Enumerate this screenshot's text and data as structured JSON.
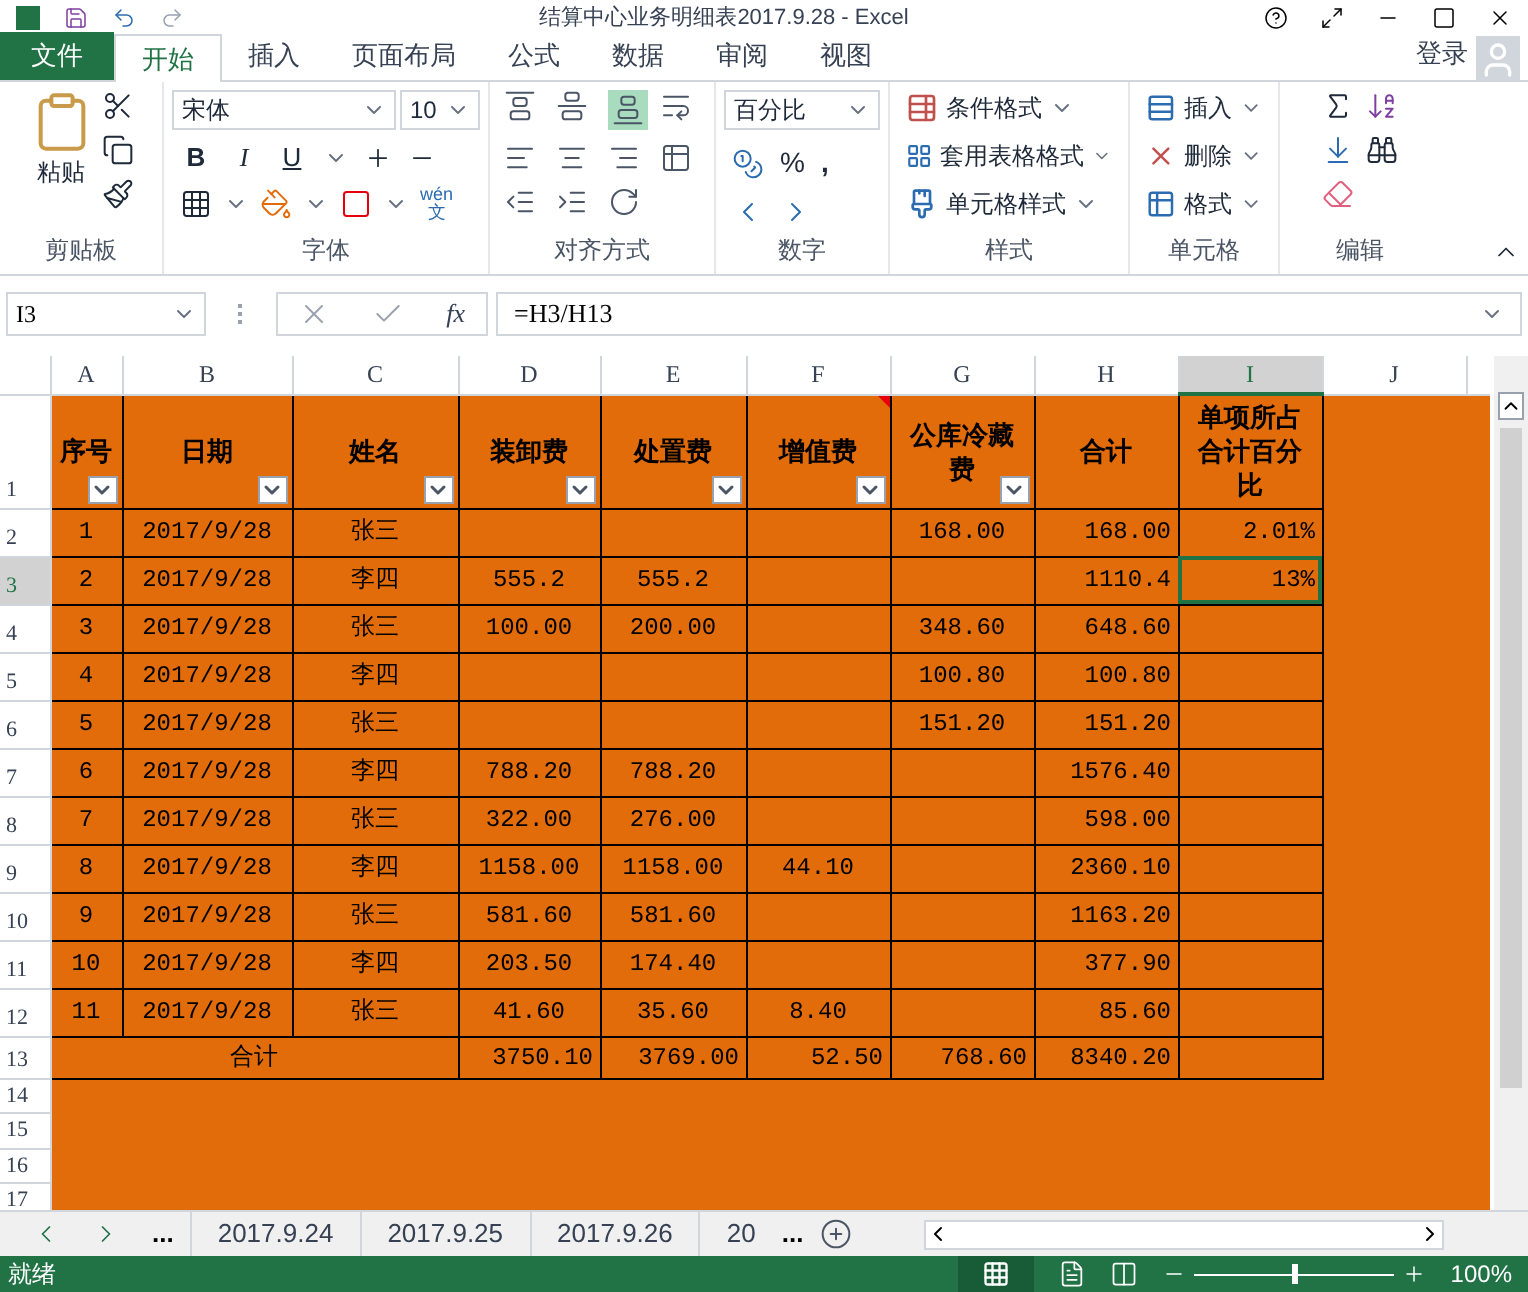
{
  "window": {
    "title": "结算中心业务明细表2017.9.28 - Excel"
  },
  "menu_tabs": [
    {
      "label": "文件",
      "kind": "file",
      "selected": false
    },
    {
      "label": "开始",
      "kind": "tab",
      "selected": true
    },
    {
      "label": "插入",
      "kind": "tab",
      "selected": false
    },
    {
      "label": "页面布局",
      "kind": "tab",
      "selected": false
    },
    {
      "label": "公式",
      "kind": "tab",
      "selected": false
    },
    {
      "label": "数据",
      "kind": "tab",
      "selected": false
    },
    {
      "label": "审阅",
      "kind": "tab",
      "selected": false
    },
    {
      "label": "视图",
      "kind": "tab",
      "selected": false
    }
  ],
  "account": {
    "label": "登录"
  },
  "ribbon": {
    "clipboard": {
      "paste": "粘贴",
      "group": "剪贴板"
    },
    "font": {
      "name": "宋体",
      "size": "10",
      "bold": "B",
      "italic": "I",
      "underline": "U",
      "phonetic": [
        "wén",
        "文"
      ],
      "group": "字体"
    },
    "alignment": {
      "group": "对齐方式"
    },
    "number": {
      "format": "百分比",
      "percent": "%",
      "comma": ",",
      "group": "数字"
    },
    "styles": {
      "items": [
        "条件格式",
        "套用表格格式",
        "单元格样式"
      ],
      "group": "样式"
    },
    "cells": {
      "items": [
        "插入",
        "删除",
        "格式"
      ],
      "group": "单元格"
    },
    "editing": {
      "group": "编辑"
    }
  },
  "formula_bar": {
    "name_box": "I3",
    "function_label": "fx",
    "formula": "=H3/H13"
  },
  "columns": [
    {
      "label": "A",
      "selected": false
    },
    {
      "label": "B",
      "selected": false
    },
    {
      "label": "C",
      "selected": false
    },
    {
      "label": "D",
      "selected": false
    },
    {
      "label": "E",
      "selected": false
    },
    {
      "label": "F",
      "selected": false
    },
    {
      "label": "G",
      "selected": false
    },
    {
      "label": "H",
      "selected": false
    },
    {
      "label": "I",
      "selected": true
    },
    {
      "label": "J",
      "selected": false
    }
  ],
  "header_row": {
    "row": "1",
    "selected": false,
    "cells": [
      {
        "text": "序号",
        "filter": true,
        "comment": false
      },
      {
        "text": "日期",
        "filter": true,
        "comment": false
      },
      {
        "text": "姓名",
        "filter": true,
        "comment": false
      },
      {
        "text": "装卸费",
        "filter": true,
        "comment": false
      },
      {
        "text": "处置费",
        "filter": true,
        "comment": false
      },
      {
        "text": "增值费",
        "filter": true,
        "comment": true
      },
      {
        "text": "公库冷藏费",
        "filter": true,
        "comment": false
      },
      {
        "text": "合计",
        "filter": false,
        "comment": false
      },
      {
        "text": "单项所占合计百分比",
        "filter": false,
        "comment": false
      }
    ]
  },
  "rows": [
    {
      "row": "2",
      "selected": false,
      "cells": [
        "1",
        "2017/9/28",
        "张三",
        null,
        null,
        null,
        "168.00",
        "168.00",
        "2.01%"
      ]
    },
    {
      "row": "3",
      "selected": true,
      "cells": [
        "2",
        "2017/9/28",
        "李四",
        "555.2",
        "555.2",
        null,
        null,
        "1110.4",
        "13%"
      ]
    },
    {
      "row": "4",
      "selected": false,
      "cells": [
        "3",
        "2017/9/28",
        "张三",
        "100.00",
        "200.00",
        null,
        "348.60",
        "648.60",
        null
      ]
    },
    {
      "row": "5",
      "selected": false,
      "cells": [
        "4",
        "2017/9/28",
        "李四",
        null,
        null,
        null,
        "100.80",
        "100.80",
        null
      ]
    },
    {
      "row": "6",
      "selected": false,
      "cells": [
        "5",
        "2017/9/28",
        "张三",
        null,
        null,
        null,
        "151.20",
        "151.20",
        null
      ]
    },
    {
      "row": "7",
      "selected": false,
      "cells": [
        "6",
        "2017/9/28",
        "李四",
        "788.20",
        "788.20",
        null,
        null,
        "1576.40",
        null
      ]
    },
    {
      "row": "8",
      "selected": false,
      "cells": [
        "7",
        "2017/9/28",
        "张三",
        "322.00",
        "276.00",
        null,
        null,
        "598.00",
        null
      ]
    },
    {
      "row": "9",
      "selected": false,
      "cells": [
        "8",
        "2017/9/28",
        "李四",
        "1158.00",
        "1158.00",
        "44.10",
        null,
        "2360.10",
        null
      ]
    },
    {
      "row": "10",
      "selected": false,
      "cells": [
        "9",
        "2017/9/28",
        "张三",
        "581.60",
        "581.60",
        null,
        null,
        "1163.20",
        null
      ]
    },
    {
      "row": "11",
      "selected": false,
      "cells": [
        "10",
        "2017/9/28",
        "李四",
        "203.50",
        "174.40",
        null,
        null,
        "377.90",
        null
      ]
    },
    {
      "row": "12",
      "selected": false,
      "cells": [
        "11",
        "2017/9/28",
        "张三",
        "41.60",
        "35.60",
        "8.40",
        null,
        "85.60",
        null
      ]
    }
  ],
  "total_row": {
    "row": "13",
    "selected": false,
    "label": "合计",
    "cells": [
      "3750.10",
      "3769.00",
      "52.50",
      "768.60",
      "8340.20",
      null
    ]
  },
  "empty_rows": [
    {
      "row": "14",
      "selected": false
    },
    {
      "row": "15",
      "selected": false
    },
    {
      "row": "16",
      "selected": false
    },
    {
      "row": "17",
      "selected": false
    }
  ],
  "sheet_tabs": {
    "more_left": "...",
    "tabs": [
      {
        "label": "2017.9.24",
        "selected": false
      },
      {
        "label": "2017.9.25",
        "selected": false
      },
      {
        "label": "2017.9.26",
        "selected": false
      },
      {
        "label": "20",
        "selected": false
      }
    ],
    "more_right": "..."
  },
  "status_bar": {
    "text": "就绪",
    "zoom": "100%",
    "level": 0.5
  }
}
